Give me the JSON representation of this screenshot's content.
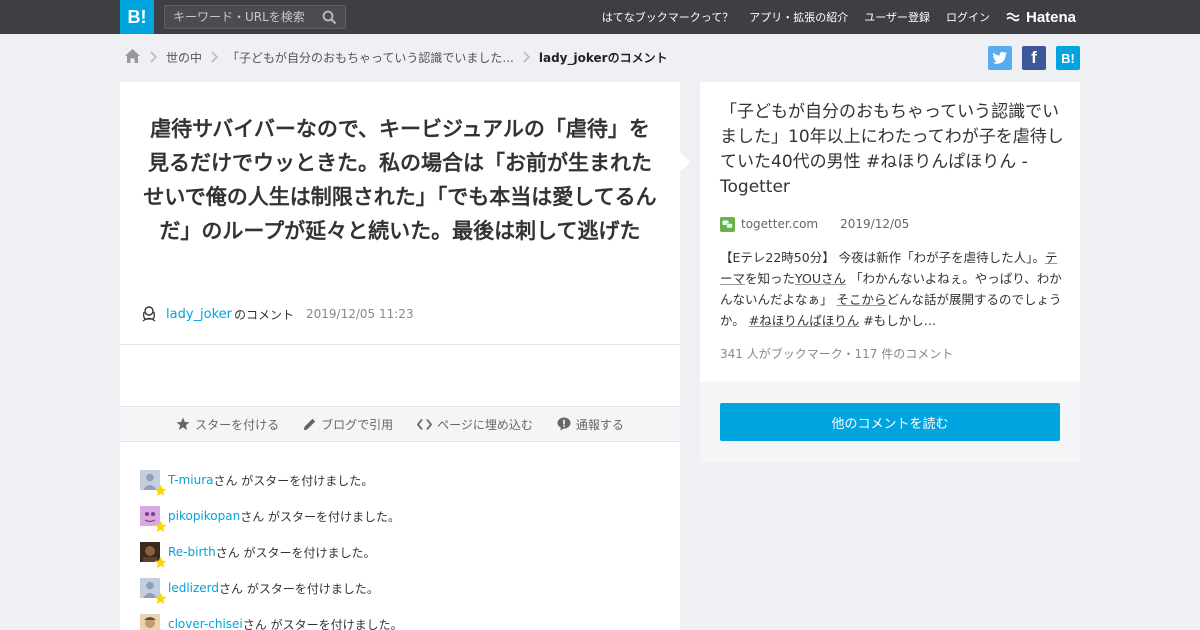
{
  "header": {
    "logo": "B!",
    "search_placeholder": "キーワード・URLを検索",
    "nav": [
      "はてなブックマークって？",
      "アプリ・拡張の紹介",
      "ユーザー登録",
      "ログイン"
    ],
    "brand": "Hatena"
  },
  "breadcrumb": {
    "items": [
      "世の中",
      "「子どもが自分のおもちゃっていう認識でいました..."
    ],
    "current": "lady_jokerのコメント"
  },
  "share": {
    "facebook": "f",
    "hatena": "B!"
  },
  "comment": {
    "text": "虐待サバイバーなので、キービジュアルの「虐待」を見るだけでウッときた。私の場合は「お前が生まれたせいで俺の人生は制限された」「でも本当は愛してるんだ」のループが延々と続いた。最後は刺して逃げた",
    "username": "lady_joker",
    "username_suffix": "のコメント",
    "datetime": "2019/12/05 11:23"
  },
  "actions": {
    "star": "スターを付ける",
    "blog": "ブログで引用",
    "embed": "ページに埋め込む",
    "report": "通報する"
  },
  "stars": {
    "suffix": "さん がスターを付けました。",
    "users": [
      {
        "name": "T-miura"
      },
      {
        "name": "pikopikopan"
      },
      {
        "name": "Re-birth"
      },
      {
        "name": "ledlizerd"
      },
      {
        "name": "clover-chisei"
      }
    ]
  },
  "entry": {
    "title": "「子どもが自分のおもちゃっていう認識でいました」10年以上にわたってわが子を虐待していた40代の男性 #ねほりんぱほりん - Togetter",
    "domain": "togetter.com",
    "date": "2019/12/05",
    "desc_parts": [
      {
        "t": "【Eテレ22時50分】 今夜は新作「わが子を虐待した人」。",
        "u": false
      },
      {
        "t": "テーマ",
        "u": true
      },
      {
        "t": "を知った",
        "u": false
      },
      {
        "t": "YOUさん",
        "u": true
      },
      {
        "t": " 「わかんないよねぇ。やっぱり、わかんないんだよなぁ」 ",
        "u": false
      },
      {
        "t": "そこから",
        "u": true
      },
      {
        "t": "どんな話が展開するのでしょうか。 ",
        "u": false
      },
      {
        "t": "#ねほりんぱほりん",
        "u": true
      },
      {
        "t": " #もしかし…",
        "u": false
      }
    ],
    "count": "341 人がブックマーク・117 件のコメント",
    "read_button": "他のコメントを読む"
  },
  "colors": {
    "accent": "#00a4de",
    "topbar": "#3d3f43",
    "star": "#f7d800"
  }
}
